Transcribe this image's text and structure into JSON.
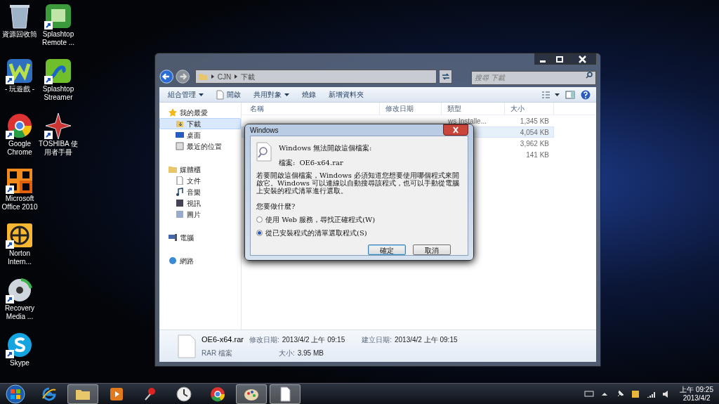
{
  "desktop_icons": [
    {
      "label": "資源回收筒",
      "kind": "bin",
      "shortcut": false
    },
    {
      "label": "- 玩遊戲 -",
      "kind": "games",
      "shortcut": true
    },
    {
      "label": "Google Chrome",
      "kind": "chrome",
      "shortcut": true
    },
    {
      "label": "Microsoft Office 2010",
      "kind": "office",
      "shortcut": true
    },
    {
      "label": "Norton Intern...",
      "kind": "globe",
      "shortcut": true
    },
    {
      "label": "Recovery Media ...",
      "kind": "disc",
      "shortcut": true
    },
    {
      "label": "Skype",
      "kind": "skype",
      "shortcut": true
    },
    {
      "label": "Splashtop Remote ...",
      "kind": "splash-remote",
      "shortcut": true
    },
    {
      "label": "Splashtop Streamer",
      "kind": "splash-stream",
      "shortcut": true
    },
    {
      "label": "TOSHIBA 使用者手冊",
      "kind": "star",
      "shortcut": true
    }
  ],
  "explorer": {
    "breadcrumb": [
      "CJN",
      "下載"
    ],
    "search": {
      "placeholder": "搜尋 下載"
    },
    "toolbar": [
      {
        "label": "組合管理",
        "dropdown": true,
        "kind": "menu"
      },
      {
        "label": "開啟",
        "dropdown": false,
        "kind": "file"
      },
      {
        "label": "共用對象",
        "dropdown": true,
        "kind": "menu"
      },
      {
        "label": "燒錄",
        "dropdown": false,
        "kind": "menu"
      },
      {
        "label": "新增資料夾",
        "dropdown": false,
        "kind": "menu"
      }
    ],
    "nav": [
      {
        "label": "我的最愛",
        "kind": "star",
        "selected": false,
        "children": [
          {
            "label": "下載",
            "kind": "download",
            "selected": true
          },
          {
            "label": "桌面",
            "kind": "desktop",
            "selected": false
          },
          {
            "label": "最近的位置",
            "kind": "recent",
            "selected": false
          }
        ]
      },
      {
        "label": "媒體櫃",
        "kind": "library",
        "selected": false,
        "children": [
          {
            "label": "文件",
            "kind": "doc",
            "selected": false
          },
          {
            "label": "音樂",
            "kind": "music",
            "selected": false
          },
          {
            "label": "視訊",
            "kind": "video",
            "selected": false
          },
          {
            "label": "圖片",
            "kind": "picture",
            "selected": false
          }
        ]
      },
      {
        "label": "電腦",
        "kind": "computer",
        "selected": false
      },
      {
        "label": "網路",
        "kind": "network",
        "selected": false
      }
    ],
    "columns": [
      "名稱",
      "修改日期",
      "類型",
      "大小"
    ],
    "rows": [
      {
        "type": "ws Installe...",
        "size": "1,345 KB",
        "selected": false
      },
      {
        "size": "4,054 KB",
        "selected": true
      },
      {
        "size": "3,962 KB",
        "selected": false
      },
      {
        "size": "141 KB",
        "selected": false
      }
    ],
    "details": {
      "name": "OE6-x64.rar",
      "file_type": "RAR 檔案",
      "fields": [
        {
          "label": "修改日期:",
          "value": "2013/4/2 上午 09:15"
        },
        {
          "label": "建立日期:",
          "value": "2013/4/2 上午 09:15"
        },
        {
          "label": "大小:",
          "value": "3.95 MB"
        }
      ]
    }
  },
  "dialog": {
    "title": "Windows",
    "heading": "Windows 無法開啟這個檔案:",
    "file_label": "檔案:",
    "file_name": "OE6-x64.rar",
    "message": "若要開啟這個檔案，Windows 必須知道您想要使用哪個程式來開啟它。Windows 可以連線以自動搜尋該程式，也可以手動從電腦上安裝的程式清單進行選取。",
    "question": "您要做什麼?",
    "options": [
      {
        "label": "使用 Web 服務，尋找正確程式(W)",
        "selected": false
      },
      {
        "label": "從已安裝程式的清單選取程式(S)",
        "selected": true
      }
    ],
    "buttons": [
      {
        "label": "確定",
        "default": true
      },
      {
        "label": "取消",
        "default": false
      }
    ]
  },
  "taskbar": {
    "apps": [
      {
        "kind": "ie",
        "active": false
      },
      {
        "kind": "folder",
        "active": true
      },
      {
        "kind": "media",
        "active": false
      },
      {
        "kind": "pin",
        "active": false
      },
      {
        "kind": "clock",
        "active": false
      },
      {
        "kind": "chrome",
        "active": false
      },
      {
        "kind": "paint",
        "active": true
      },
      {
        "kind": "doc",
        "active": true
      }
    ],
    "time": "上午 09:25",
    "date": "2013/4/2"
  }
}
